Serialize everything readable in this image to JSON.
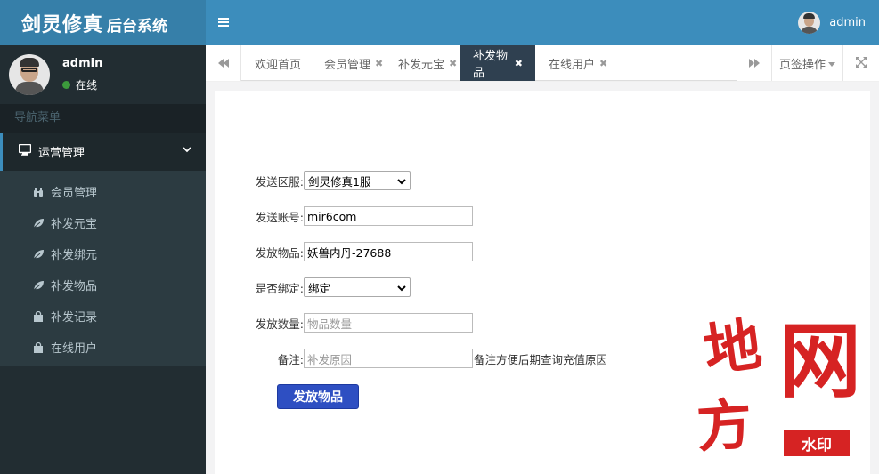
{
  "app": {
    "logo_title": "剑灵修真",
    "logo_subtitle": "后台系统"
  },
  "user": {
    "name": "admin",
    "status": "在线"
  },
  "sidebar": {
    "nav_header": "导航菜单",
    "group_label": "运营管理",
    "items": [
      {
        "label": "会员管理",
        "icon": "binoculars-icon"
      },
      {
        "label": "补发元宝",
        "icon": "leaf-icon"
      },
      {
        "label": "补发绑元",
        "icon": "leaf-icon"
      },
      {
        "label": "补发物品",
        "icon": "leaf-icon"
      },
      {
        "label": "补发记录",
        "icon": "shopping-bag-icon"
      },
      {
        "label": "在线用户",
        "icon": "shopping-bag-icon"
      }
    ]
  },
  "header": {
    "user_name": "admin"
  },
  "tabs": {
    "items": [
      {
        "label": "欢迎首页"
      },
      {
        "label": "会员管理"
      },
      {
        "label": "补发元宝"
      },
      {
        "label": "补发物品"
      },
      {
        "label": "在线用户"
      }
    ],
    "active_index": 3,
    "page_ops_label": "页签操作"
  },
  "form": {
    "server_label": "发送区服:",
    "server_value": "剑灵修真1服",
    "account_label": "发送账号:",
    "account_value": "mir6com",
    "item_label": "发放物品:",
    "item_value": "妖兽内丹-27688",
    "bind_label": "是否绑定:",
    "bind_value": "绑定",
    "qty_label": "发放数量:",
    "qty_placeholder": "物品数量",
    "remark_label": "备注:",
    "remark_placeholder": "补发原因",
    "remark_hint": "备注方便后期查询充值原因",
    "submit_label": "发放物品"
  },
  "watermark": {
    "chars": [
      "地",
      "方",
      "网"
    ],
    "badge": "水印"
  },
  "colors": {
    "header_bg": "#3c8dbc",
    "sidebar_bg": "#222d32",
    "active_tab_bg": "#2f4050",
    "submit_bg": "#2e4fc2",
    "watermark": "#d62323"
  }
}
